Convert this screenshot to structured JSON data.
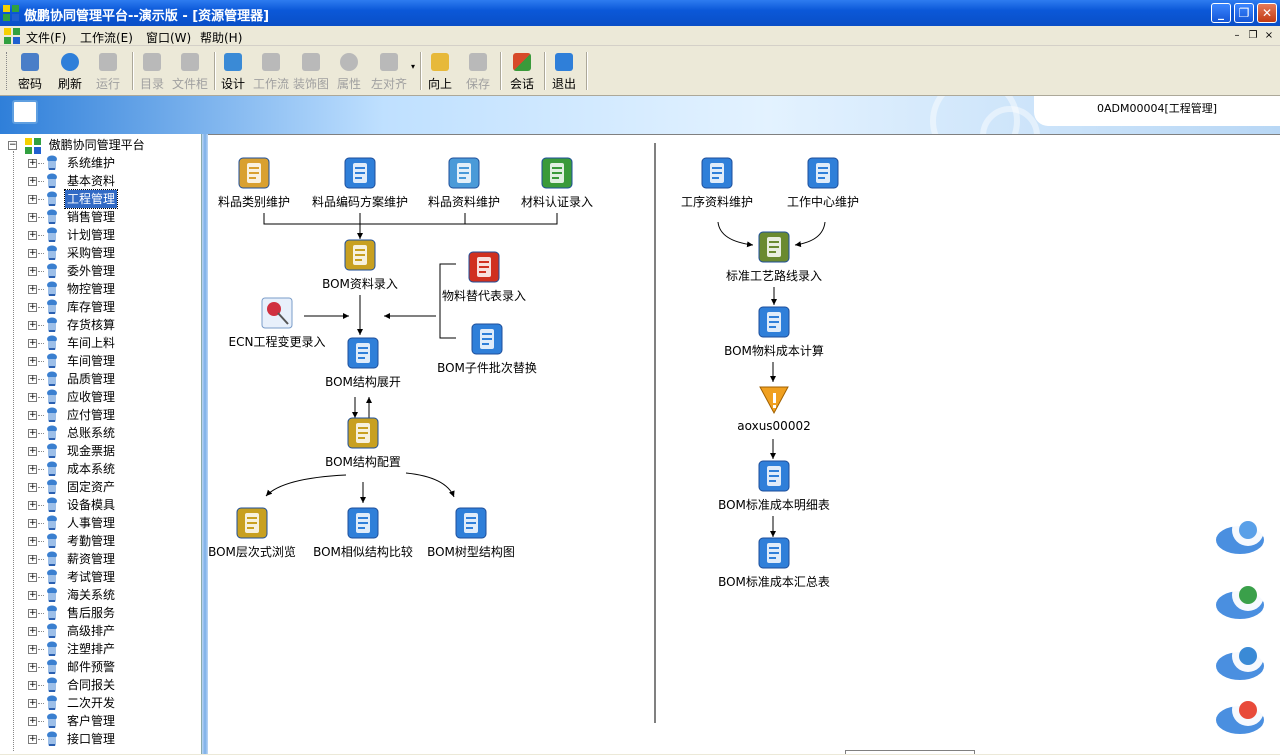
{
  "window": {
    "title": "傲鹏协同管理平台--演示版  - [资源管理器]",
    "controls": {
      "minimize": "_",
      "maximize": "❐",
      "close": "✕"
    }
  },
  "menubar": {
    "items": [
      {
        "label": "文件(F)"
      },
      {
        "label": "工作流(E)"
      },
      {
        "label": "窗口(W)"
      },
      {
        "label": "帮助(H)"
      }
    ],
    "mdi": {
      "minimize": "–",
      "restore": "❐",
      "close": "×"
    }
  },
  "toolbar": {
    "buttons": [
      {
        "label": "密码",
        "icon": "lock-icon",
        "color": "#4a7ec8",
        "enabled": true
      },
      {
        "label": "刷新",
        "icon": "refresh-icon",
        "color": "#2f7fd9",
        "enabled": true
      },
      {
        "label": "运行",
        "icon": "run-icon",
        "color": "#999999",
        "enabled": false
      },
      {
        "label": "目录",
        "icon": "folder-icon",
        "color": "#999999",
        "enabled": false
      },
      {
        "label": "文件柜",
        "icon": "cabinet-icon",
        "color": "#999999",
        "enabled": false
      },
      {
        "label": "设计",
        "icon": "design-icon",
        "color": "#3a8ad6",
        "enabled": true
      },
      {
        "label": "工作流",
        "icon": "workflow-icon",
        "color": "#999999",
        "enabled": false
      },
      {
        "label": "装饰图",
        "icon": "decor-icon",
        "color": "#999999",
        "enabled": false
      },
      {
        "label": "属性",
        "icon": "gear-icon",
        "color": "#999999",
        "enabled": false
      },
      {
        "label": "左对齐",
        "icon": "align-left-icon",
        "color": "#999999",
        "enabled": false
      },
      {
        "label": "向上",
        "icon": "up-folder-icon",
        "color": "#e7b93a",
        "enabled": true
      },
      {
        "label": "保存",
        "icon": "save-icon",
        "color": "#999999",
        "enabled": false
      },
      {
        "label": "会话",
        "icon": "chat-icon",
        "color": "#d74a2a",
        "enabled": true
      },
      {
        "label": "退出",
        "icon": "exit-icon",
        "color": "#2f7fd9",
        "enabled": true
      }
    ]
  },
  "banner": {
    "user_tab": "0ADM00004[工程管理]"
  },
  "tree": {
    "root": "傲鹏协同管理平台",
    "items": [
      {
        "label": "系统维护"
      },
      {
        "label": "基本资料"
      },
      {
        "label": "工程管理",
        "selected": true
      },
      {
        "label": "销售管理"
      },
      {
        "label": "计划管理"
      },
      {
        "label": "采购管理"
      },
      {
        "label": "委外管理"
      },
      {
        "label": "物控管理"
      },
      {
        "label": "库存管理"
      },
      {
        "label": "存货核算"
      },
      {
        "label": "车间上料"
      },
      {
        "label": "车间管理"
      },
      {
        "label": "品质管理"
      },
      {
        "label": "应收管理"
      },
      {
        "label": "应付管理"
      },
      {
        "label": "总账系统"
      },
      {
        "label": "现金票据"
      },
      {
        "label": "成本系统"
      },
      {
        "label": "固定资产"
      },
      {
        "label": "设备模具"
      },
      {
        "label": "人事管理"
      },
      {
        "label": "考勤管理"
      },
      {
        "label": "薪资管理"
      },
      {
        "label": "考试管理"
      },
      {
        "label": "海关系统"
      },
      {
        "label": "售后服务"
      },
      {
        "label": "高级排产"
      },
      {
        "label": "注塑排产"
      },
      {
        "label": "邮件预警"
      },
      {
        "label": "合同报关"
      },
      {
        "label": "二次开发"
      },
      {
        "label": "客户管理"
      },
      {
        "label": "接口管理"
      }
    ]
  },
  "flow": {
    "nodes": [
      {
        "id": "item-category",
        "label": "料品类别维护",
        "icon": "cube-stack-icon",
        "color": "#d9a030"
      },
      {
        "id": "item-coding",
        "label": "料品编码方案维护",
        "icon": "document-icon",
        "color": "#2f7fd9"
      },
      {
        "id": "item-master",
        "label": "料品资料维护",
        "icon": "database-icon",
        "color": "#4a9ad8"
      },
      {
        "id": "material-cert",
        "label": "材料认证录入",
        "icon": "spreadsheet-x-icon",
        "color": "#3a9a3a"
      },
      {
        "id": "bom-entry",
        "label": "BOM资料录入",
        "icon": "pencil-doc-icon",
        "color": "#c8a020"
      },
      {
        "id": "substitute",
        "label": "物料替代表录入",
        "icon": "report-icon",
        "color": "#d03020"
      },
      {
        "id": "ecn",
        "label": "ECN工程变更录入",
        "icon": "pushpin-icon",
        "color": "#d03040"
      },
      {
        "id": "bom-expand",
        "label": "BOM结构展开",
        "icon": "document-icon",
        "color": "#2f7fd9"
      },
      {
        "id": "bom-batch",
        "label": "BOM子件批次替换",
        "icon": "document-icon",
        "color": "#2f7fd9"
      },
      {
        "id": "bom-config",
        "label": "BOM结构配置",
        "icon": "pencil-doc-icon",
        "color": "#c8a020"
      },
      {
        "id": "bom-level",
        "label": "BOM层次式浏览",
        "icon": "pencil-doc-icon",
        "color": "#c8a020"
      },
      {
        "id": "bom-compare",
        "label": "BOM相似结构比较",
        "icon": "document-icon",
        "color": "#2f7fd9"
      },
      {
        "id": "bom-tree",
        "label": "BOM树型结构图",
        "icon": "document-icon",
        "color": "#2f7fd9"
      },
      {
        "id": "process-data",
        "label": "工序资料维护",
        "icon": "machine-icon",
        "color": "#2f7fd9"
      },
      {
        "id": "work-center",
        "label": "工作中心维护",
        "icon": "document-icon",
        "color": "#2f7fd9"
      },
      {
        "id": "routing",
        "label": "标准工艺路线录入",
        "icon": "keyboard-icon",
        "color": "#6a8a30"
      },
      {
        "id": "bom-cost",
        "label": "BOM物料成本计算",
        "icon": "document-icon",
        "color": "#2f7fd9"
      },
      {
        "id": "aoxus",
        "label": "aoxus00002",
        "icon": "warning-icon",
        "color": "#f0a020"
      },
      {
        "id": "bom-std-detail",
        "label": "BOM标准成本明细表",
        "icon": "document-icon",
        "color": "#2f7fd9"
      },
      {
        "id": "bom-std-summary",
        "label": "BOM标准成本汇总表",
        "icon": "document-icon",
        "color": "#2f7fd9"
      }
    ]
  },
  "launcher": [
    {
      "icon": "computer-icon"
    },
    {
      "icon": "email-icon"
    },
    {
      "icon": "messenger-icon"
    },
    {
      "icon": "notepad-icon"
    }
  ]
}
